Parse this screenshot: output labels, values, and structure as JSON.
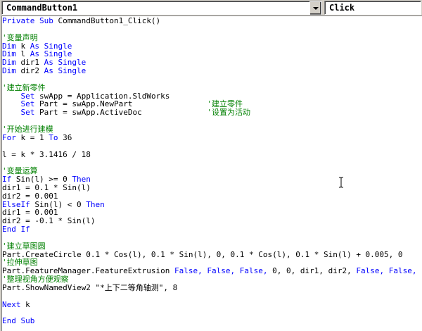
{
  "header": {
    "object_combo_value": "CommandButton1",
    "procedure_combo_value": "Click"
  },
  "code": {
    "lines": [
      [
        {
          "t": "Private Sub ",
          "c": "kw"
        },
        {
          "t": "CommandButton1_Click()",
          "c": "tx"
        }
      ],
      [],
      [
        {
          "t": "'变量声明",
          "c": "cm"
        }
      ],
      [
        {
          "t": "Dim ",
          "c": "kw"
        },
        {
          "t": "k ",
          "c": "tx"
        },
        {
          "t": "As Single",
          "c": "kw"
        }
      ],
      [
        {
          "t": "Dim ",
          "c": "kw"
        },
        {
          "t": "l ",
          "c": "tx"
        },
        {
          "t": "As Single",
          "c": "kw"
        }
      ],
      [
        {
          "t": "Dim ",
          "c": "kw"
        },
        {
          "t": "dir1 ",
          "c": "tx"
        },
        {
          "t": "As Single",
          "c": "kw"
        }
      ],
      [
        {
          "t": "Dim ",
          "c": "kw"
        },
        {
          "t": "dir2 ",
          "c": "tx"
        },
        {
          "t": "As Single",
          "c": "kw"
        }
      ],
      [],
      [
        {
          "t": "'建立新零件",
          "c": "cm"
        }
      ],
      [
        {
          "t": "    ",
          "c": "tx"
        },
        {
          "t": "Set ",
          "c": "kw"
        },
        {
          "t": "swApp = Application.SldWorks",
          "c": "tx"
        }
      ],
      [
        {
          "t": "    ",
          "c": "tx"
        },
        {
          "t": "Set ",
          "c": "kw"
        },
        {
          "t": "Part = swApp.NewPart                ",
          "c": "tx"
        },
        {
          "t": "'建立零件",
          "c": "cm"
        }
      ],
      [
        {
          "t": "    ",
          "c": "tx"
        },
        {
          "t": "Set ",
          "c": "kw"
        },
        {
          "t": "Part = swApp.ActiveDoc              ",
          "c": "tx"
        },
        {
          "t": "'设置为活动",
          "c": "cm"
        }
      ],
      [],
      [
        {
          "t": "'开始进行建模",
          "c": "cm"
        }
      ],
      [
        {
          "t": "For ",
          "c": "kw"
        },
        {
          "t": "k = 1 ",
          "c": "tx"
        },
        {
          "t": "To ",
          "c": "kw"
        },
        {
          "t": "36",
          "c": "tx"
        }
      ],
      [],
      [
        {
          "t": "l = k * 3.1416 / 18",
          "c": "tx"
        }
      ],
      [],
      [
        {
          "t": "'变量运算",
          "c": "cm"
        }
      ],
      [
        {
          "t": "If ",
          "c": "kw"
        },
        {
          "t": "Sin(l) >= 0 ",
          "c": "tx"
        },
        {
          "t": "Then",
          "c": "kw"
        }
      ],
      [
        {
          "t": "dir1 = 0.1 * Sin(l)",
          "c": "tx"
        }
      ],
      [
        {
          "t": "dir2 = 0.001",
          "c": "tx"
        }
      ],
      [
        {
          "t": "ElseIf ",
          "c": "kw"
        },
        {
          "t": "Sin(l) < 0 ",
          "c": "tx"
        },
        {
          "t": "Then",
          "c": "kw"
        }
      ],
      [
        {
          "t": "dir1 = 0.001",
          "c": "tx"
        }
      ],
      [
        {
          "t": "dir2 = -0.1 * Sin(l)",
          "c": "tx"
        }
      ],
      [
        {
          "t": "End If",
          "c": "kw"
        }
      ],
      [],
      [
        {
          "t": "'建立草图圆",
          "c": "cm"
        }
      ],
      [
        {
          "t": "Part.CreateCircle 0.1 * Cos(l), 0.1 * Sin(l), 0, 0.1 * Cos(l), 0.1 * Sin(l) + 0.005, 0",
          "c": "tx"
        }
      ],
      [
        {
          "t": "'拉伸草图",
          "c": "cm"
        }
      ],
      [
        {
          "t": "Part.FeatureManager.FeatureExtrusion ",
          "c": "tx"
        },
        {
          "t": "False, False, False, ",
          "c": "kw"
        },
        {
          "t": "0, 0, dir1, dir2, ",
          "c": "tx"
        },
        {
          "t": "False, False, False, F",
          "c": "kw"
        }
      ],
      [
        {
          "t": "'整理视角方便观察",
          "c": "cm"
        }
      ],
      [
        {
          "t": "Part.ShowNamedView2 \"*上下二等角轴测\", 8",
          "c": "tx"
        }
      ],
      [],
      [
        {
          "t": "Next ",
          "c": "kw"
        },
        {
          "t": "k",
          "c": "tx"
        }
      ],
      [],
      [
        {
          "t": "End Sub",
          "c": "kw"
        }
      ]
    ]
  },
  "colors": {
    "keyword": "#0000ff",
    "comment": "#008000",
    "text": "#000000",
    "editor_background": "#ffffff",
    "chrome": "#d4d0c8"
  },
  "icons": {
    "object_dropdown": "chevron-down-icon",
    "procedure_dropdown": "chevron-down-icon",
    "caret": "i-beam-cursor-icon"
  }
}
